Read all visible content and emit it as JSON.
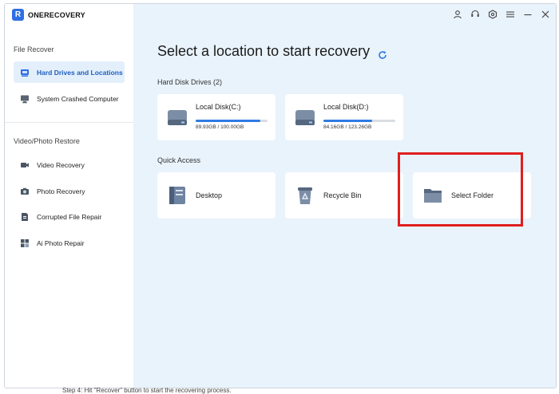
{
  "app": {
    "name": "ONERECOVERY",
    "logo_letter": "R"
  },
  "sidebar": {
    "file_recover_title": "File Recover",
    "file_items": [
      {
        "label": "Hard Drives and Locations",
        "icon": "hard-drive-icon",
        "active": true
      },
      {
        "label": "System Crashed Computer",
        "icon": "computer-icon",
        "active": false
      }
    ],
    "media_title": "Video/Photo Restore",
    "media_items": [
      {
        "label": "Video Recovery",
        "icon": "video-icon"
      },
      {
        "label": "Photo Recovery",
        "icon": "camera-icon"
      },
      {
        "label": "Corrupted File Repair",
        "icon": "file-repair-icon"
      },
      {
        "label": "Ai Photo Repair",
        "icon": "photo-repair-icon"
      }
    ]
  },
  "titlebar": {
    "icons": [
      "user-icon",
      "support-icon",
      "settings-icon",
      "menu-icon",
      "minimize-icon",
      "close-icon"
    ]
  },
  "main": {
    "heading": "Select a location to start recovery",
    "hard_disk_title": "Hard Disk Drives (2)",
    "disks": [
      {
        "name": "Local Disk(C:)",
        "size": "89.93GB / 100.00GB",
        "usage": 0.9
      },
      {
        "name": "Local Disk(D:)",
        "size": "84.16GB / 123.26GB",
        "usage": 0.68
      }
    ],
    "quick_access_title": "Quick Access",
    "quick_access": [
      {
        "label": "Desktop",
        "icon": "desktop-icon"
      },
      {
        "label": "Recycle Bin",
        "icon": "recycle-bin-icon"
      },
      {
        "label": "Select Folder",
        "icon": "folder-icon"
      }
    ]
  },
  "colors": {
    "accent": "#2f7be3",
    "highlight": "#e01e1e",
    "main_bg": "#e9f3fc",
    "active_bg": "#e3effb"
  },
  "footer": {
    "text": "Step 4: Hit \"Recover\" button to start the recovering process."
  }
}
